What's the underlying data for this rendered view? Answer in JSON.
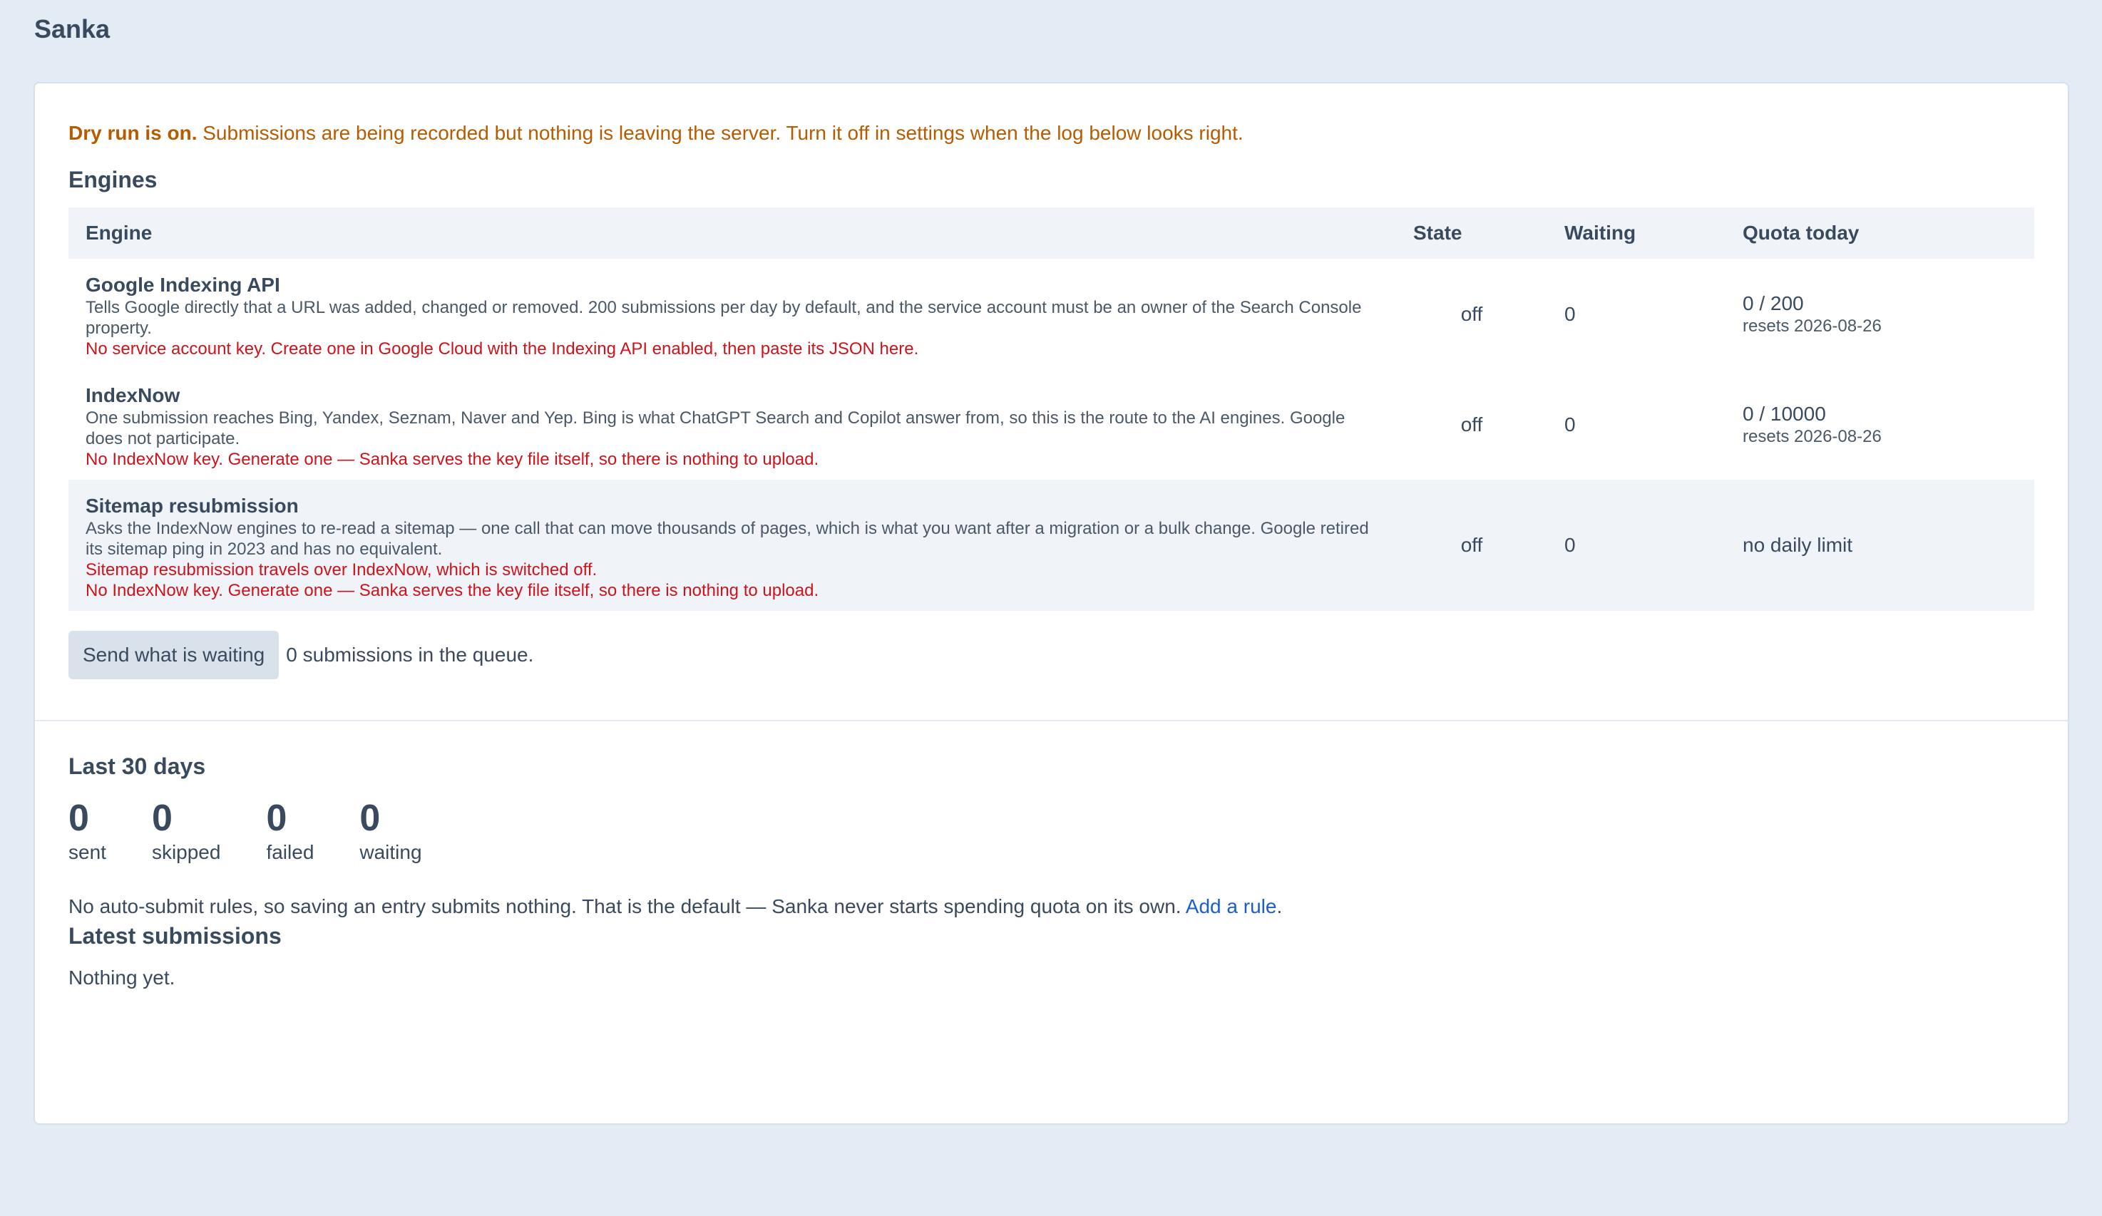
{
  "app": {
    "title": "Sanka"
  },
  "notice": {
    "bold": "Dry run is on.",
    "text": " Submissions are being recorded but nothing is leaving the server. Turn it off in settings when the log below looks right.",
    "color": "#b85b00"
  },
  "engines": {
    "heading": "Engines",
    "columns": [
      "Engine",
      "State",
      "Waiting",
      "Quota today"
    ],
    "rows": [
      {
        "name": "Google Indexing API",
        "desc": "Tells Google directly that a URL was added, changed or removed. 200 submissions per day by default, and the service account must be an owner of the Search Console property.",
        "warnings": [
          "No service account key. Create one in Google Cloud with the Indexing API enabled, then paste its JSON here."
        ],
        "state": "off",
        "waiting": "0",
        "quota": "0 / 200",
        "quota_sub": "resets 2026-08-26"
      },
      {
        "name": "IndexNow",
        "desc": "One submission reaches Bing, Yandex, Seznam, Naver and Yep. Bing is what ChatGPT Search and Copilot answer from, so this is the route to the AI engines. Google does not participate.",
        "warnings": [
          "No IndexNow key. Generate one — Sanka serves the key file itself, so there is nothing to upload."
        ],
        "state": "off",
        "waiting": "0",
        "quota": "0 / 10000",
        "quota_sub": "resets 2026-08-26"
      },
      {
        "name": "Sitemap resubmission",
        "desc": "Asks the IndexNow engines to re-read a sitemap — one call that can move thousands of pages, which is what you want after a migration or a bulk change. Google retired its sitemap ping in 2023 and has no equivalent.",
        "warnings": [
          "Sitemap resubmission travels over IndexNow, which is switched off.",
          "No IndexNow key. Generate one — Sanka serves the key file itself, so there is nothing to upload."
        ],
        "state": "off",
        "waiting": "0",
        "quota": "no daily limit",
        "quota_sub": ""
      }
    ],
    "warning_color": "#d0121b"
  },
  "queue": {
    "button_label": "Send what is waiting",
    "text": "0 submissions in the queue."
  },
  "stats": {
    "heading": "Last 30 days",
    "items": [
      {
        "value": "0",
        "label": "sent"
      },
      {
        "value": "0",
        "label": "skipped"
      },
      {
        "value": "0",
        "label": "failed"
      },
      {
        "value": "0",
        "label": "waiting"
      }
    ]
  },
  "rules": {
    "text": "No auto-submit rules, so saving an entry submits nothing. That is the default — Sanka never starts spending quota on its own. ",
    "link": "Add a rule",
    "after": ".",
    "link_color": "#1a5fd0"
  },
  "latest": {
    "heading": "Latest submissions",
    "empty": "Nothing yet."
  }
}
